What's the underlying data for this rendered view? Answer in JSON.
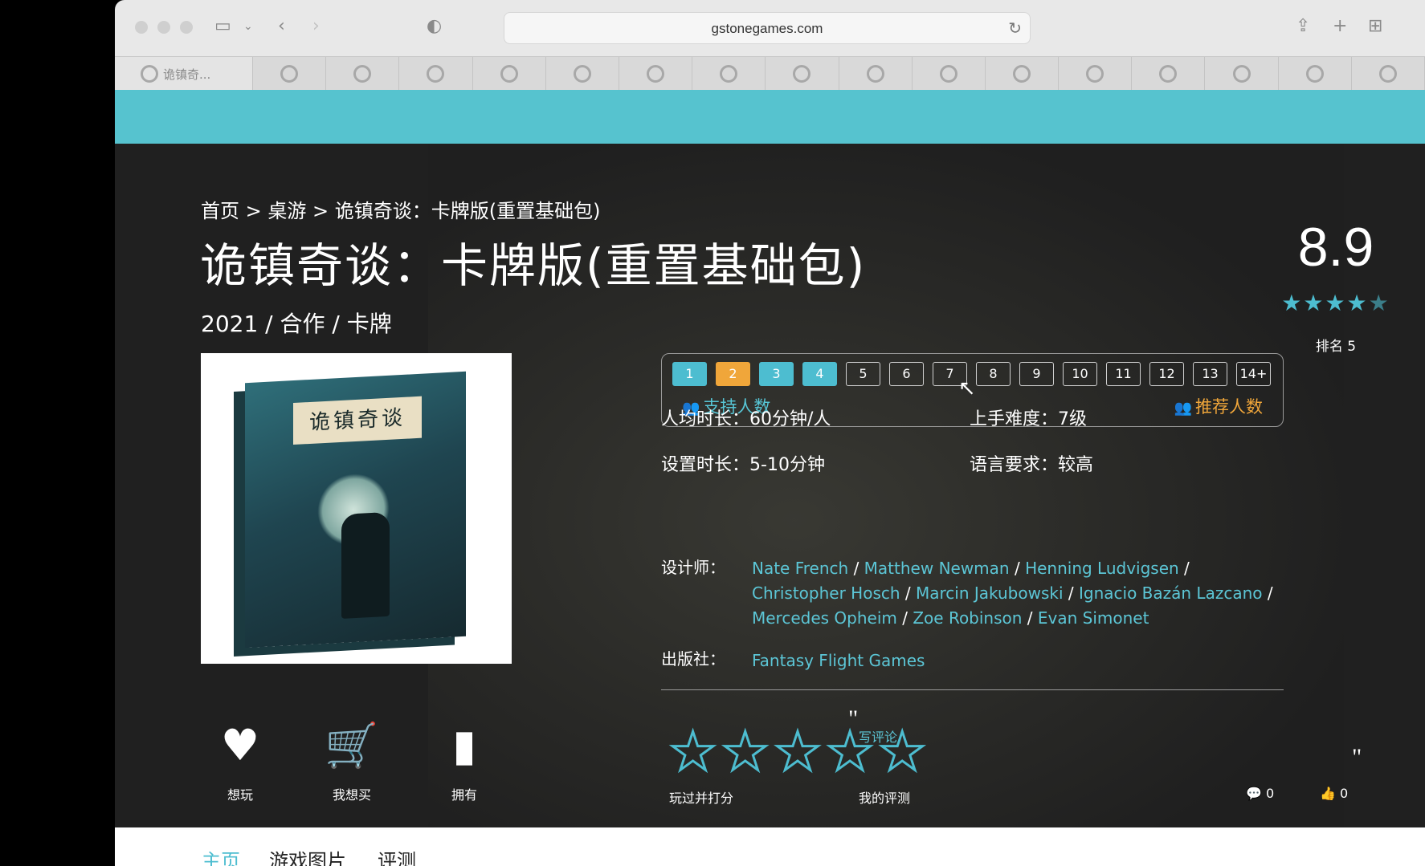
{
  "browser": {
    "url": "gstonegames.com",
    "first_tab_label": "诡镇奇...",
    "tab_count": 17
  },
  "breadcrumb": "首页 > 桌游 > 诡镇奇谈：卡牌版(重置基础包)",
  "game": {
    "title": "诡镇奇谈：卡牌版(重置基础包)",
    "meta": "2021 / 合作 / 卡牌",
    "cover_label": "诡镇奇谈",
    "score": "8.9",
    "rating_stars": 4.5,
    "rank": "排名 5"
  },
  "players": {
    "counts": [
      "1",
      "2",
      "3",
      "4",
      "5",
      "6",
      "7",
      "8",
      "9",
      "10",
      "11",
      "12",
      "13",
      "14+"
    ],
    "support_label": "支持人数",
    "recommend_label": "推荐人数"
  },
  "info": {
    "avg_time_label": "人均时长：",
    "avg_time_value": "60分钟/人",
    "difficulty_label": "上手难度：",
    "difficulty_value": "7级",
    "setup_label": "设置时长：",
    "setup_value": "5-10分钟",
    "language_label": "语言要求：",
    "language_value": "较高",
    "designer_label": "设计师：",
    "designers": [
      "Nate French",
      "Matthew Newman",
      "Henning Ludvigsen",
      "Christopher Hosch",
      "Marcin Jakubowski",
      "Ignacio Bazán Lazcano",
      "Mercedes Opheim",
      "Zoe Robinson",
      "Evan Simonet"
    ],
    "publisher_label": "出版社：",
    "publisher": "Fantasy Flight Games"
  },
  "actions": {
    "want_play": "想玩",
    "want_buy": "我想买",
    "own": "拥有",
    "rate_label": "玩过并打分",
    "write_review": "写评论",
    "my_review": "我的评测",
    "comments": "0",
    "likes": "0"
  },
  "bottom_tabs": [
    "主页",
    "游戏图片",
    "评测"
  ],
  "colors": {
    "teal": "#4dbdd0",
    "orange": "#f0a63a",
    "banner": "#56c3cf"
  }
}
